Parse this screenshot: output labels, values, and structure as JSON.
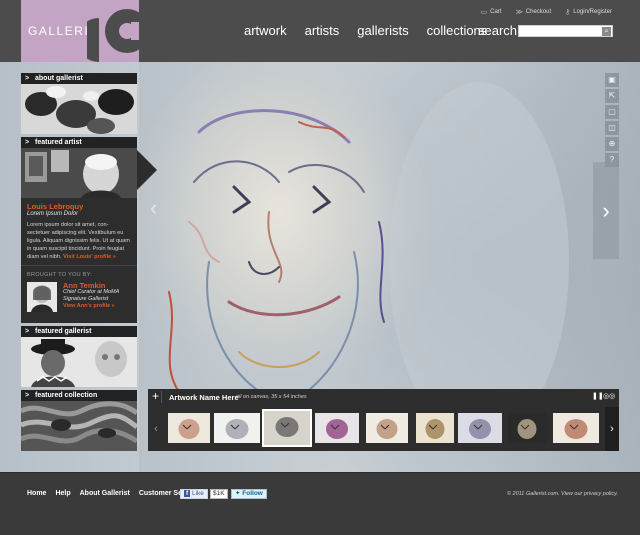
{
  "brand": {
    "name": "GALLERIST",
    "accent": "#c4a4c4",
    "link_color": "#e25a2b"
  },
  "top_links": [
    {
      "label": "Cart",
      "icon": "cart-icon"
    },
    {
      "label": "Checkout",
      "icon": "checkout-icon"
    },
    {
      "label": "Login/Register",
      "icon": "key-icon"
    }
  ],
  "nav": {
    "items": [
      "artwork",
      "artists",
      "gallerists",
      "collections"
    ],
    "search_label": "search:",
    "search_value": ""
  },
  "sidebar": {
    "about": {
      "title": "about gallerist"
    },
    "featured_artist": {
      "title": "featured artist",
      "name": "Louis Lebroquy",
      "subtitle": "Lorem Ipsum Dolor",
      "bio": "Lorem ipsum dolor sit amet, con-sectetuer adipiscing elit. Vestibulum eu ligula. Aliquam dignissim felis. Ut at quam in quam suscipit tincidunt. Proin feugiat diam vel nibh.",
      "profile_link": "Visit Louis' profile »",
      "brought_by": "BROUGHT TO YOU BY:",
      "curator_name": "Ann Temkin",
      "curator_role": "Chief Curator at MoMA",
      "curator_org": "Signature Gallerist",
      "curator_link": "View Ann's profile »"
    },
    "featured_gallerist": {
      "title": "featured gallerist"
    },
    "featured_collection": {
      "title": "featured collection"
    }
  },
  "tools": [
    "gallery-icon",
    "share-icon",
    "frame-icon",
    "bookmark-icon",
    "zoom-icon",
    "help-icon"
  ],
  "filmstrip": {
    "title": "Artwork Name Here",
    "subtitle": "oil on canvas, 35 x 54 inches",
    "plus": "+",
    "pause": "❚❚",
    "options": "◎◎",
    "active_index": 2,
    "thumb_count": 10
  },
  "footer": {
    "links": [
      "Home",
      "Help",
      "About Gallerist",
      "Customer Service"
    ],
    "fb_like": "Like",
    "fb_count": "$1K",
    "twitter": "Follow",
    "copyright": "© 2011 Gallerist.com. View our privacy policy."
  }
}
